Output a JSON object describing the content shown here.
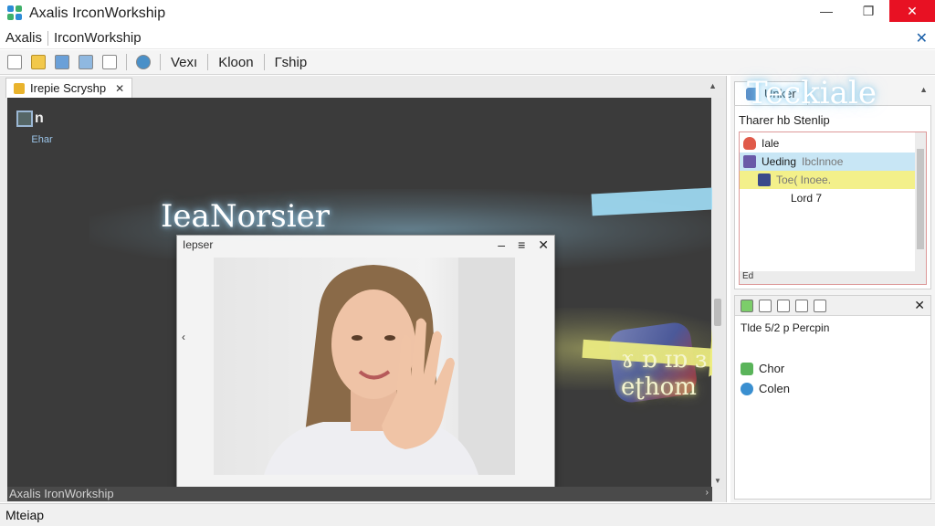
{
  "window": {
    "title": "Axalis IrconWorkship",
    "controls": {
      "minimize": "—",
      "maximize": "❐",
      "close": "✕"
    }
  },
  "menubar": {
    "items": [
      "Axalis",
      "IrconWorkship"
    ],
    "close": "✕"
  },
  "toolbar": {
    "icons": [
      "new-icon",
      "open-icon",
      "copy-icon",
      "paste-icon",
      "export-icon",
      "globe-icon"
    ],
    "buttons": [
      "Vexı",
      "Kloon",
      "Гship"
    ]
  },
  "document": {
    "tab": {
      "label": "Irepie Scryshp",
      "close": "✕"
    },
    "desktop_icon": {
      "glyph": "n",
      "label": "Ehar"
    },
    "preview_window": {
      "title": "Iepser",
      "title_controls": [
        "–",
        "≡",
        "✕"
      ],
      "left_arrow": "‹",
      "close_bottom": "✕"
    },
    "overlays": {
      "left_text": "IeaNorsier",
      "right_text": "Teckiale",
      "bottom_text": "ɤ ɒ ɪɒ ɜ eʈhom"
    },
    "hscroll_label": "Axalis IronWorkship",
    "hscroll_arrow": "›"
  },
  "right_pane": {
    "tab_label": "Unker",
    "heading": "Tharer hb Stenlip",
    "list": {
      "rows": [
        {
          "label": "Iale",
          "extra": ""
        },
        {
          "label": "Ueding",
          "extra": "Ibclnnoe"
        },
        {
          "label": "",
          "extra": "Toe( Inoee."
        },
        {
          "label": "Lord 7",
          "extra": ""
        }
      ],
      "hscroll_label": "Ed",
      "plus": "+"
    },
    "panel2": {
      "close": "✕",
      "heading": "Tlde 5/2 p Percpin",
      "items": [
        "Chor",
        "Colen"
      ]
    }
  },
  "statusbar": {
    "text": "Mteiap"
  },
  "colors": {
    "titlebar_close": "#e81123",
    "canvas": "#3b3b3b",
    "highlight_blue": "#c8e6f5",
    "highlight_yellow": "#f3f08a",
    "accent": "#1a5fa8"
  }
}
